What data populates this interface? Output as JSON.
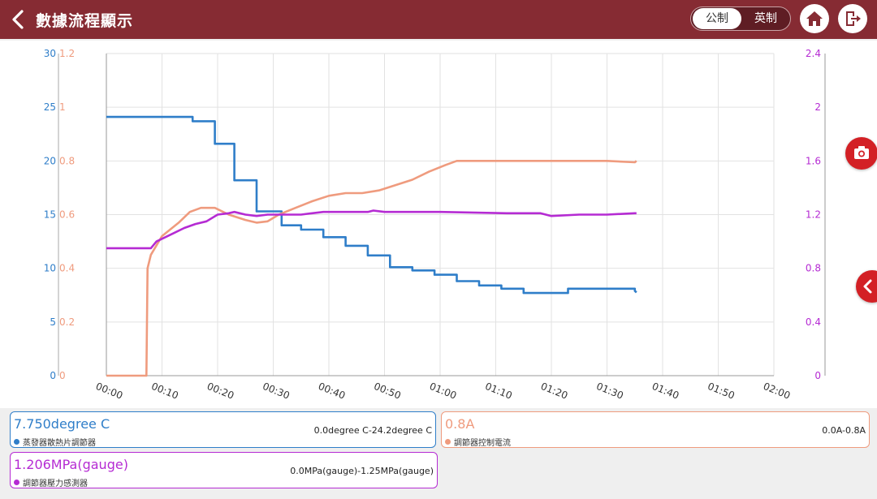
{
  "header": {
    "title": "數據流程顯示",
    "unit_metric": "公制",
    "unit_imperial": "英制"
  },
  "colors": {
    "header": "#862b33",
    "blue": "#2f7ec9",
    "orange": "#ef9b7e",
    "purple": "#b52bd3",
    "accent_red": "#d32025"
  },
  "icons": {
    "back": "chevron-left-icon",
    "home": "home-icon",
    "exit": "exit-icon",
    "camera": "camera-icon",
    "expand": "chevron-left-icon"
  },
  "chart_data": {
    "type": "line",
    "x_ticks": [
      "00:00",
      "00:10",
      "00:20",
      "00:30",
      "00:40",
      "00:50",
      "01:00",
      "01:10",
      "01:20",
      "01:30",
      "01:40",
      "01:50",
      "02:00"
    ],
    "xlim": [
      0,
      120
    ],
    "grid": true,
    "y_axes": [
      {
        "side": "left-outer",
        "ticks": [
          "0",
          "5",
          "10",
          "15",
          "20",
          "25",
          "30"
        ],
        "ylim": [
          0,
          30
        ],
        "color": "#2f7ec9"
      },
      {
        "side": "left-inner",
        "ticks": [
          "0",
          "0.2",
          "0.4",
          "0.6",
          "0.8",
          "1",
          "1.2"
        ],
        "ylim": [
          0,
          1.2
        ],
        "color": "#ef9b7e"
      },
      {
        "side": "right",
        "ticks": [
          "0",
          "0.4",
          "0.8",
          "1.2",
          "1.6",
          "2",
          "2.4"
        ],
        "ylim": [
          0,
          2.4
        ],
        "color": "#b52bd3"
      }
    ],
    "series": [
      {
        "name": "蒸發器散熱片調節器",
        "axis": 0,
        "color": "#2f7ec9",
        "x": [
          0,
          15.5,
          15.5,
          19.5,
          19.5,
          23,
          23,
          27,
          27,
          31.5,
          31.5,
          35,
          35,
          39,
          39,
          43,
          43,
          47,
          47,
          51,
          51,
          55,
          55,
          59,
          59,
          63,
          63,
          67,
          67,
          71,
          71,
          75,
          75,
          80,
          80,
          83,
          83,
          87,
          87,
          95,
          95,
          95.3
        ],
        "y": [
          24.1,
          24.1,
          23.7,
          23.7,
          21.6,
          21.6,
          18.2,
          18.2,
          15.3,
          15.3,
          14,
          14,
          13.6,
          13.6,
          12.9,
          12.9,
          12.1,
          12.1,
          11.2,
          11.2,
          10.1,
          10.1,
          9.8,
          9.8,
          9.4,
          9.4,
          8.8,
          8.8,
          8.4,
          8.4,
          8.1,
          8.1,
          7.7,
          7.7,
          7.7,
          7.7,
          8.1,
          8.1,
          8.1,
          8.1,
          7.9,
          7.75
        ]
      },
      {
        "name": "調節器控制電流",
        "axis": 1,
        "color": "#ef9b7e",
        "x": [
          0,
          7.2,
          7.3,
          7.4,
          8,
          10,
          13,
          15,
          17,
          19.5,
          22,
          25,
          27,
          29,
          31,
          34,
          37,
          40,
          43,
          46,
          49,
          52,
          55,
          58,
          61,
          63,
          66,
          70,
          75,
          80,
          85,
          90,
          95,
          95.3
        ],
        "y": [
          0,
          0,
          0.2,
          0.4,
          0.45,
          0.52,
          0.57,
          0.61,
          0.625,
          0.625,
          0.6,
          0.58,
          0.57,
          0.575,
          0.6,
          0.625,
          0.65,
          0.67,
          0.68,
          0.68,
          0.69,
          0.71,
          0.73,
          0.76,
          0.785,
          0.8,
          0.8,
          0.8,
          0.8,
          0.8,
          0.8,
          0.8,
          0.795,
          0.8
        ]
      },
      {
        "name": "調節器壓力感測器",
        "axis": 2,
        "color": "#b52bd3",
        "x": [
          0,
          8,
          9,
          10,
          12,
          14,
          16,
          18,
          20,
          22,
          23,
          25,
          27,
          29,
          31,
          33,
          35,
          37,
          39,
          41,
          47,
          48,
          50,
          60,
          72,
          78,
          80,
          85,
          90,
          95,
          95.3
        ],
        "y": [
          0.95,
          0.95,
          1.0,
          1.02,
          1.06,
          1.1,
          1.13,
          1.15,
          1.2,
          1.21,
          1.22,
          1.2,
          1.19,
          1.2,
          1.2,
          1.2,
          1.2,
          1.21,
          1.22,
          1.22,
          1.22,
          1.23,
          1.22,
          1.22,
          1.21,
          1.21,
          1.19,
          1.2,
          1.2,
          1.21,
          1.21
        ]
      }
    ]
  },
  "cards": [
    {
      "value": "7.750degree C",
      "name": "蒸發器散熱片調節器",
      "range": "0.0degree C-24.2degree C",
      "color": "#2f7ec9"
    },
    {
      "value": "0.8A",
      "name": "調節器控制電流",
      "range": "0.0A-0.8A",
      "color": "#ef9b7e"
    },
    {
      "value": "1.206MPa(gauge)",
      "name": "調節器壓力感測器",
      "range": "0.0MPa(gauge)-1.25MPa(gauge)",
      "color": "#b52bd3"
    }
  ]
}
